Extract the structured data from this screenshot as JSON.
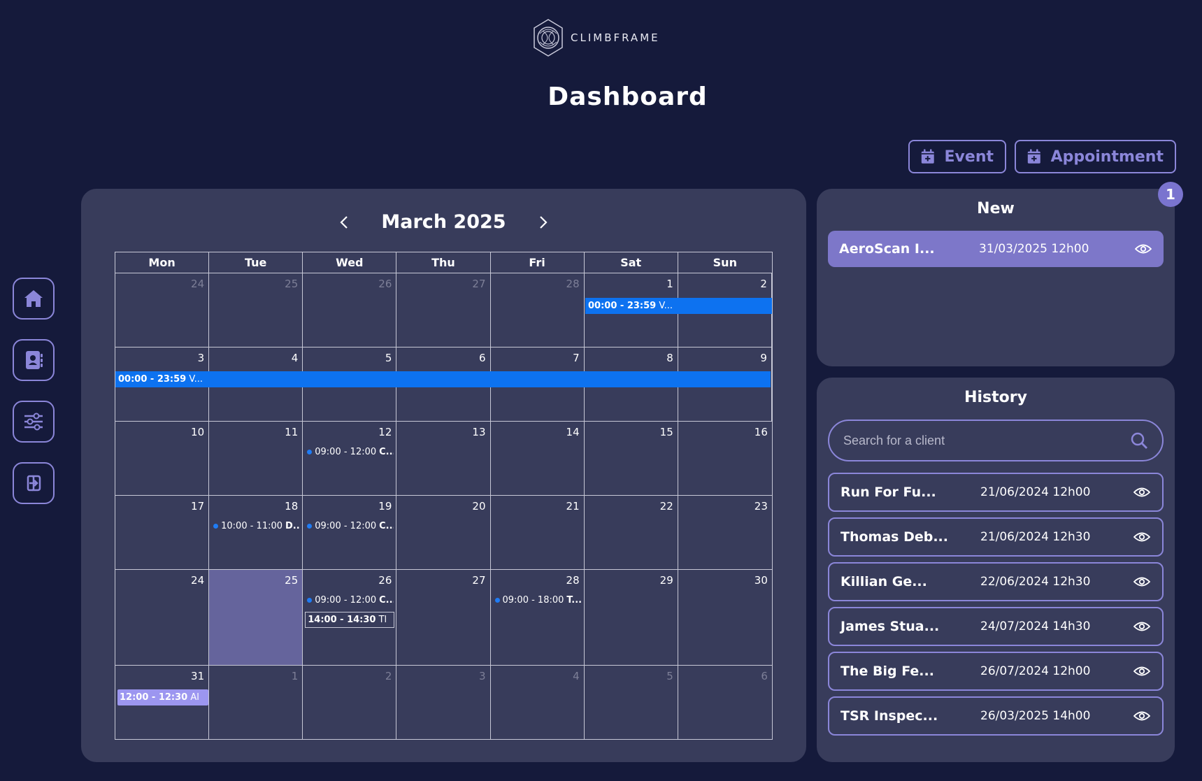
{
  "brand": {
    "name": "CLIMBFRAME"
  },
  "page": {
    "title": "Dashboard"
  },
  "actions": {
    "event_label": "Event",
    "appointment_label": "Appointment"
  },
  "sidebar": {
    "items": [
      "home-icon",
      "contacts-icon",
      "sliders-icon",
      "logout-icon"
    ]
  },
  "calendar": {
    "month_label": "March 2025",
    "weekdays": [
      "Mon",
      "Tue",
      "Wed",
      "Thu",
      "Fri",
      "Sat",
      "Sun"
    ],
    "weeks": [
      [
        "24",
        "25",
        "26",
        "27",
        "28",
        "1",
        "2"
      ],
      [
        "3",
        "4",
        "5",
        "6",
        "7",
        "8",
        "9"
      ],
      [
        "10",
        "11",
        "12",
        "13",
        "14",
        "15",
        "16"
      ],
      [
        "17",
        "18",
        "19",
        "20",
        "21",
        "22",
        "23"
      ],
      [
        "24",
        "25",
        "26",
        "27",
        "28",
        "29",
        "30"
      ],
      [
        "31",
        "1",
        "2",
        "3",
        "4",
        "5",
        "6"
      ]
    ],
    "events": {
      "w1_vac_time": "00:00 - 23:59",
      "w1_vac_title": "V...",
      "w2_vac_time": "00:00 - 23:59",
      "w2_vac_title": "V...",
      "d12_time": "09:00 - 12:00",
      "d12_title": "C...",
      "d18_time": "10:00 - 11:00",
      "d18_title": "D...",
      "d19_time": "09:00 - 12:00",
      "d19_title": "C...",
      "d26a_time": "09:00 - 12:00",
      "d26a_title": "C...",
      "d26b_time": "14:00 - 14:30",
      "d26b_title": "Tl",
      "d28_time": "09:00 - 18:00",
      "d28_title": "T...",
      "d31_time": "12:00 - 12:30",
      "d31_title": "Al"
    }
  },
  "new_panel": {
    "title": "New",
    "badge_count": "1",
    "items": [
      {
        "name": "AeroScan I...",
        "date": "31/03/2025 12h00"
      }
    ]
  },
  "history_panel": {
    "title": "History",
    "search_placeholder": "Search for a client",
    "items": [
      {
        "name": "Run For Fu...",
        "date": "21/06/2024 12h00"
      },
      {
        "name": "Thomas Deb...",
        "date": "21/06/2024 12h30"
      },
      {
        "name": "Killian Ge...",
        "date": "22/06/2024 12h30"
      },
      {
        "name": "James Stua...",
        "date": "24/07/2024 14h30"
      },
      {
        "name": "The Big Fe...",
        "date": "26/07/2024 12h00"
      },
      {
        "name": "TSR Inspec...",
        "date": "26/03/2025 14h00"
      }
    ]
  },
  "colors": {
    "background": "#151a3b",
    "card": "#383c5b",
    "accent": "#8b86d9",
    "event_blue": "#0d72f0",
    "today": "#65649c"
  }
}
